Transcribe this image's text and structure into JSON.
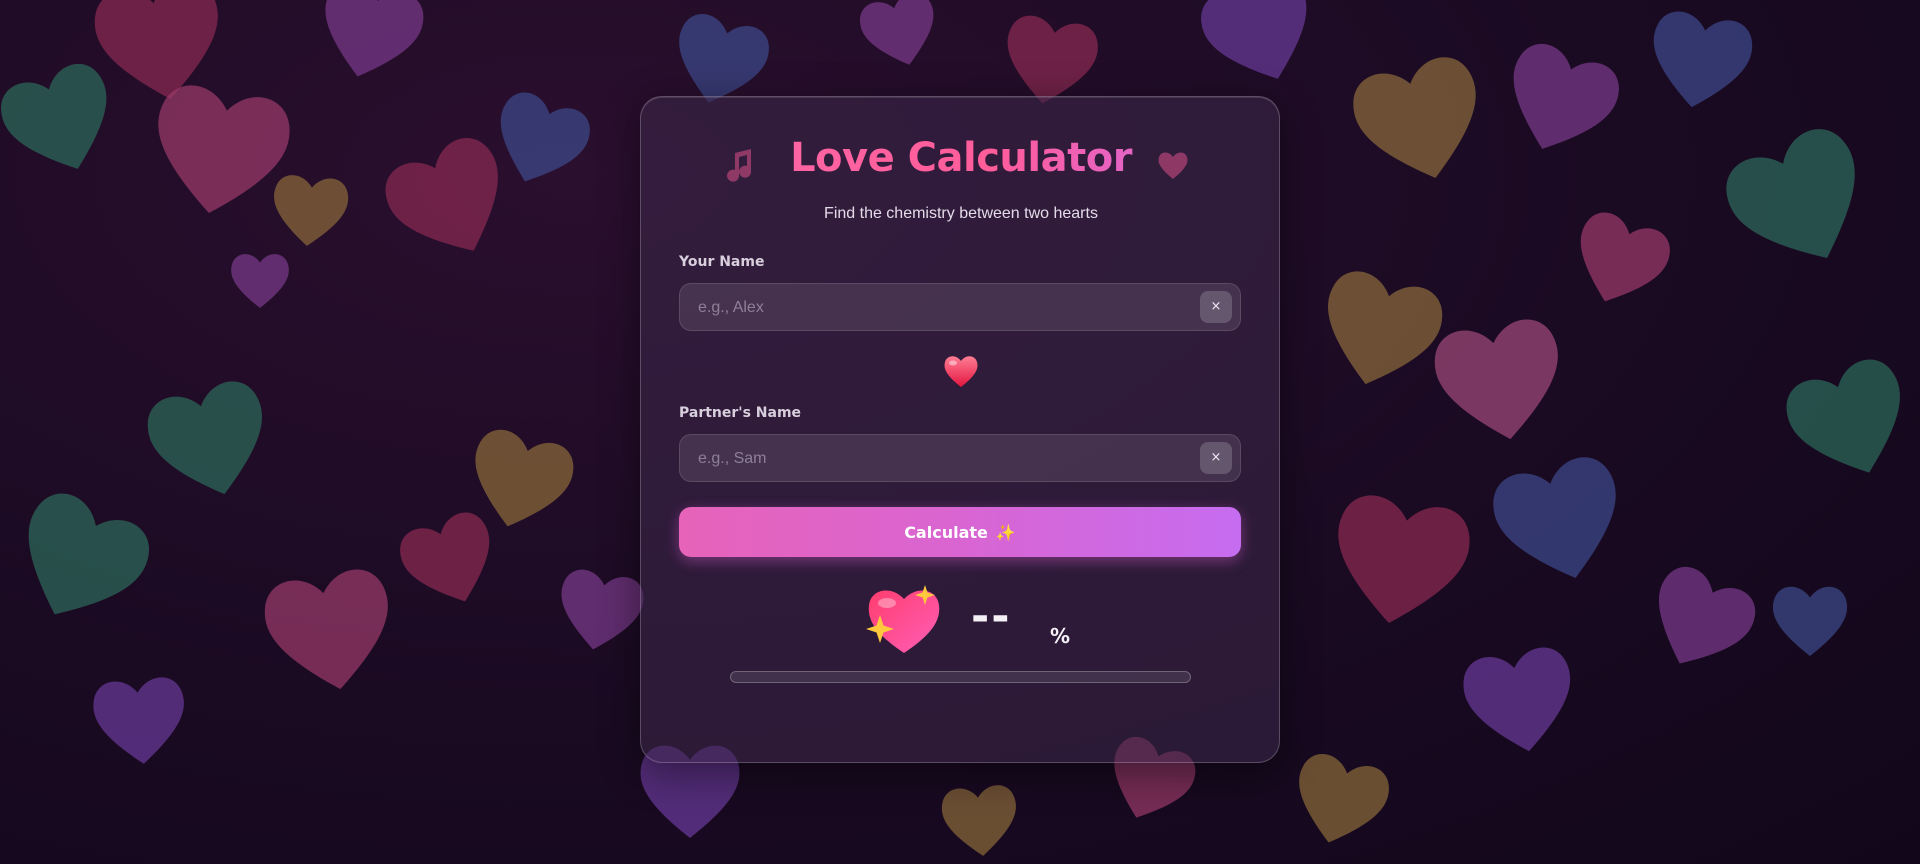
{
  "app": {
    "title": "Love Calculator",
    "subtitle": "Find the chemistry between two hearts"
  },
  "form": {
    "your_name": {
      "label": "Your Name",
      "value": "",
      "placeholder": "e.g., Alex",
      "clear_label": "×"
    },
    "partner_name": {
      "label": "Partner's Name",
      "value": "",
      "placeholder": "e.g., Sam",
      "clear_label": "×"
    }
  },
  "divider_icon": "heart-icon",
  "calculate_button": {
    "label": "Calculate",
    "emoji": "✨"
  },
  "result": {
    "icon": "sparkling-heart-icon",
    "value": "--",
    "unit": "%",
    "progress_fraction": 0
  },
  "colors": {
    "title_start": "#ff6aa8",
    "title_end": "#c86cf2",
    "button_start": "#e763b9",
    "button_end": "#c66cf0"
  }
}
